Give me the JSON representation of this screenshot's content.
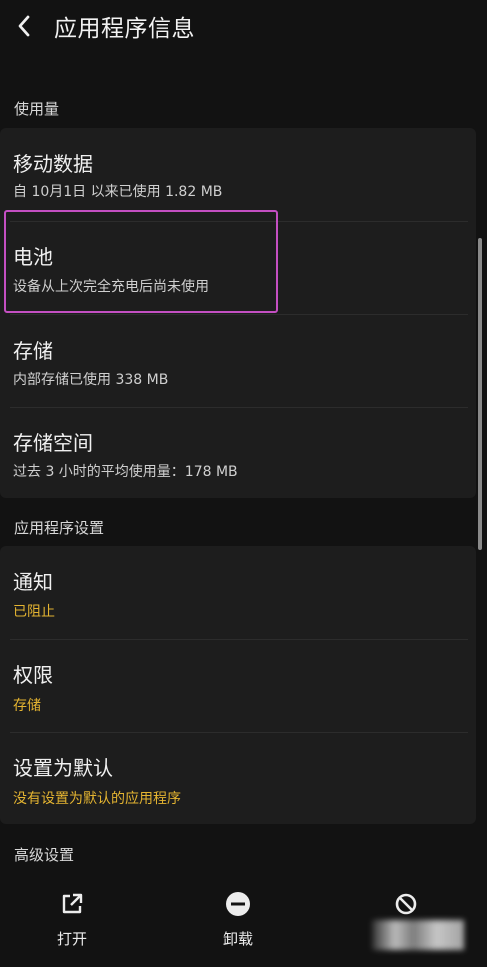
{
  "header": {
    "title": "应用程序信息"
  },
  "sections": {
    "usage": {
      "title": "使用量",
      "items": [
        {
          "title": "移动数据",
          "subtitle": "自 10月1日 以来已使用 1.82 MB"
        },
        {
          "title": "电池",
          "subtitle": "设备从上次完全充电后尚未使用"
        },
        {
          "title": "存储",
          "subtitle": "内部存储已使用 338 MB"
        },
        {
          "title": "存储空间",
          "subtitle": "过去 3 小时的平均使用量：178 MB"
        }
      ]
    },
    "app_settings": {
      "title": "应用程序设置",
      "items": [
        {
          "title": "通知",
          "subtitle": "已阻止"
        },
        {
          "title": "权限",
          "subtitle": "存储"
        },
        {
          "title": "设置为默认",
          "subtitle": "没有设置为默认的应用程序"
        }
      ]
    },
    "advanced": {
      "title": "高级设置"
    }
  },
  "bottom_bar": {
    "open": "打开",
    "uninstall": "卸载"
  },
  "colors": {
    "background": "#121212",
    "card": "#1d1d1d",
    "accent": "#e4b431",
    "highlight": "#c44fc2"
  }
}
